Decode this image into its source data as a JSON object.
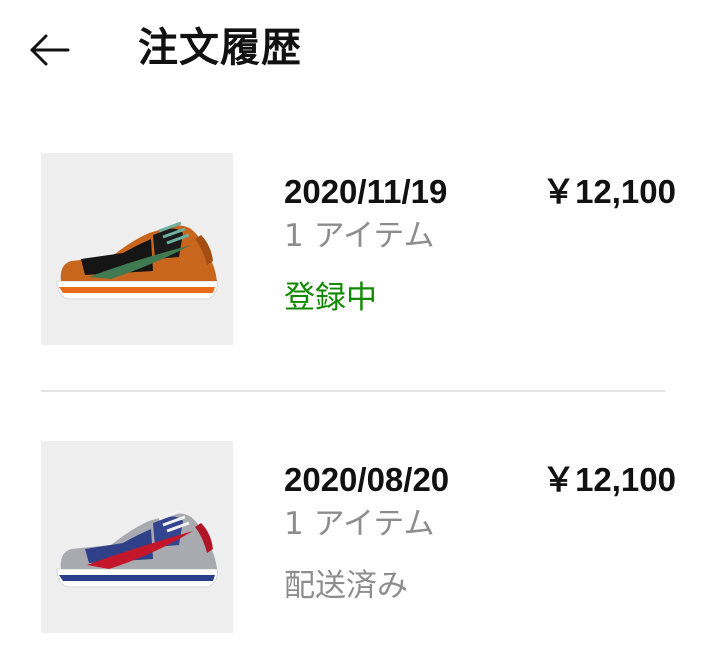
{
  "header": {
    "back_icon": "arrow-left-icon",
    "title": "注文履歴"
  },
  "orders": [
    {
      "date": "2020/11/19",
      "price": "￥12,100",
      "item_count": "1 アイテム",
      "status": "登録中",
      "status_color": "#128a00",
      "image": "orange-black-green-sneaker-image"
    },
    {
      "date": "2020/08/20",
      "price": "￥12,100",
      "item_count": "1 アイテム",
      "status": "配送済み",
      "status_color": "#8d8d8d",
      "image": "grey-navy-red-sneaker-image"
    }
  ],
  "colors": {
    "text": "#111111",
    "muted": "#8d8d8d",
    "status_green": "#128a00",
    "thumb_bg": "#efefef",
    "divider": "#e5e5e5"
  }
}
